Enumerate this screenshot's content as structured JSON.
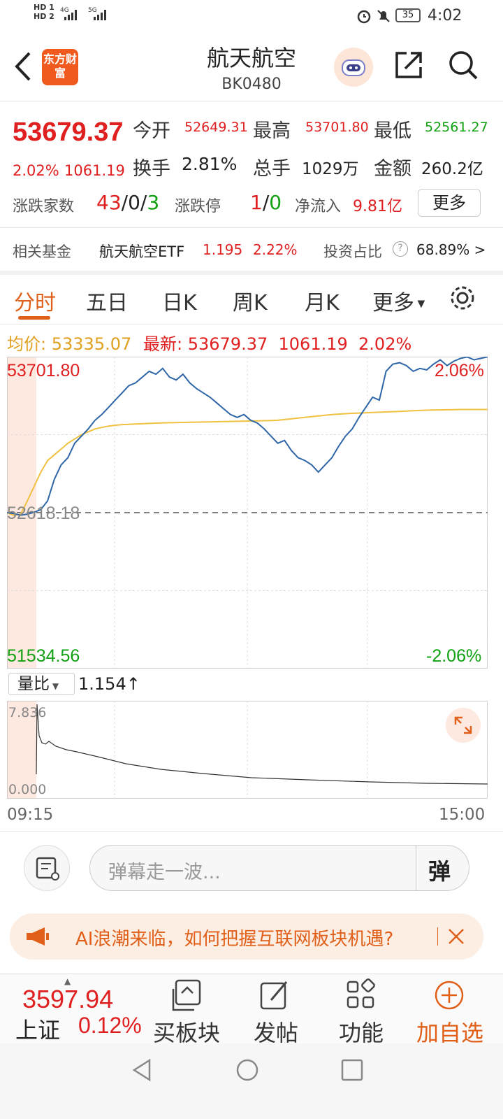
{
  "status": {
    "time": "4:02",
    "battery": "35",
    "sim1": "HD 1",
    "sim2": "HD 2",
    "net1": "4G",
    "net2": "5G"
  },
  "header": {
    "logo_text": "东方财富",
    "title": "航天航空",
    "code": "BK0480"
  },
  "quote": {
    "price": "53679.37",
    "pct": "2.02%",
    "change": "1061.19",
    "open_label": "今开",
    "open": "52649.31",
    "high_label": "最高",
    "high": "53701.80",
    "low_label": "最低",
    "low": "52561.27",
    "turnover_label": "换手",
    "turnover": "2.81%",
    "volume_label": "总手",
    "volume": "1029万",
    "amount_label": "金额",
    "amount": "260.2亿",
    "breadth_label": "涨跌家数",
    "up": "43",
    "flat": "0",
    "down": "3",
    "limit_label": "涨跌停",
    "limit_up": "1",
    "limit_down": "0",
    "netflow_label": "净流入",
    "netflow": "9.81亿",
    "more_label": "更多"
  },
  "fund": {
    "label": "相关基金",
    "name": "航天航空ETF",
    "price": "1.195",
    "pct": "2.22%",
    "ratio_label": "投资占比",
    "ratio": "68.89%",
    "arrow": ">"
  },
  "tabs": [
    "分时",
    "五日",
    "日K",
    "周K",
    "月K",
    "更多"
  ],
  "legend": {
    "avg_label": "均价:",
    "avg": "53335.07",
    "latest_label": "最新:",
    "latest": "53679.37",
    "change": "1061.19",
    "pct": "2.02%"
  },
  "chart_labels": {
    "top": "53701.80",
    "top_pct": "2.06%",
    "mid": "52618.18",
    "bottom": "51534.56",
    "bottom_pct": "-2.06%"
  },
  "volume_ratio": {
    "label": "量比",
    "value": "1.154↑",
    "top": "7.836",
    "bottom": "0.000",
    "time_start": "09:15",
    "time_end": "15:00"
  },
  "danmu": {
    "placeholder": "弹幕走一波...",
    "btn": "弹"
  },
  "banner": {
    "text": "AI浪潮来临，如何把握互联网板块机遇?"
  },
  "bottom": {
    "index_value": "3597.94",
    "index_name": "上证",
    "index_pct": "0.12%",
    "nav": [
      "买板块",
      "发帖",
      "功能",
      "加自选"
    ]
  },
  "colors": {
    "accent": "#e0601a",
    "up": "#e02020",
    "down": "#12a112",
    "price_line": "#2e66a8",
    "avg_line": "#f0c040"
  },
  "chart_data": {
    "type": "line",
    "ylim": [
      51534.56,
      53701.8
    ],
    "baseline": 52618.18,
    "series": [
      {
        "name": "最新",
        "values": [
          52618,
          52612,
          52600,
          52608,
          52620,
          52640,
          52700,
          52850,
          52950,
          53000,
          53100,
          53150,
          53200,
          53260,
          53300,
          53350,
          53400,
          53450,
          53500,
          53520,
          53560,
          53600,
          53580,
          53620,
          53560,
          53540,
          53580,
          53520,
          53480,
          53450,
          53420,
          53380,
          53340,
          53300,
          53280,
          53300,
          53260,
          53240,
          53200,
          53150,
          53100,
          53120,
          53050,
          53000,
          52980,
          52950,
          52900,
          52950,
          53000,
          53080,
          53150,
          53200,
          53280,
          53350,
          53420,
          53400,
          53600,
          53650,
          53660,
          53640,
          53600,
          53620,
          53610,
          53650,
          53680,
          53640,
          53670,
          53690,
          53700,
          53680,
          53690,
          53701
        ]
      },
      {
        "name": "均价",
        "values": [
          52618,
          52600,
          52605,
          52700,
          52800,
          52900,
          52980,
          53020,
          53060,
          53100,
          53130,
          53160,
          53180,
          53200,
          53210,
          53220,
          53225,
          53230,
          53232,
          53234,
          53236,
          53238,
          53240,
          53242,
          53243,
          53244,
          53245,
          53246,
          53247,
          53248,
          53249,
          53250,
          53251,
          53252,
          53253,
          53254,
          53255,
          53256,
          53257,
          53258,
          53260,
          53265,
          53270,
          53275,
          53280,
          53285,
          53290,
          53295,
          53300,
          53303,
          53306,
          53308,
          53310,
          53312,
          53314,
          53316,
          53318,
          53320,
          53322,
          53324,
          53326,
          53328,
          53330,
          53331,
          53332,
          53333,
          53334,
          53335,
          53335,
          53335,
          53335,
          53335
        ]
      }
    ]
  }
}
